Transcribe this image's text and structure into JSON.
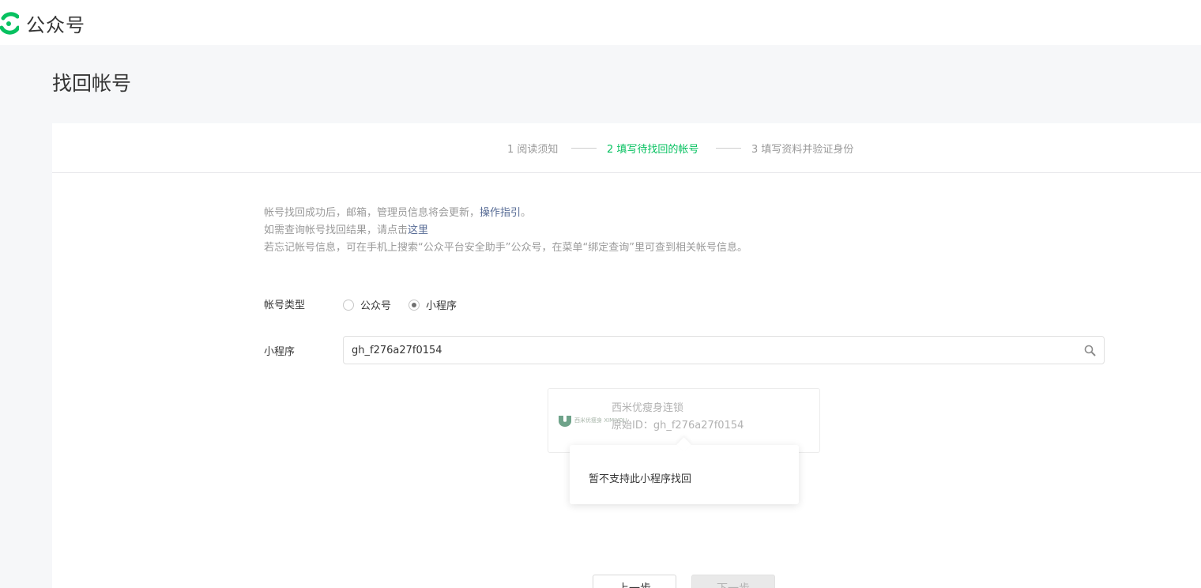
{
  "brand": {
    "name": "公众号",
    "accent": "#07c160"
  },
  "page": {
    "title": "找回帐号"
  },
  "steps": [
    {
      "label": "1 阅读须知",
      "active": false
    },
    {
      "label": "2 填写待找回的帐号",
      "active": true
    },
    {
      "label": "3 填写资料并验证身份",
      "active": false
    }
  ],
  "notice": {
    "line1_text": "帐号找回成功后，邮箱，管理员信息将会更新，",
    "line1_link": "操作指引",
    "line1_end": "。",
    "line2_text": "如需查询帐号找回结果，请点击",
    "line2_link": "这里",
    "line3_text": "若忘记帐号信息，可在手机上搜索“公众平台安全助手”公众号，在菜单“绑定查询”里可查到相关帐号信息。"
  },
  "form": {
    "type_label": "帐号类型",
    "options": [
      {
        "label": "公众号",
        "checked": false
      },
      {
        "label": "小程序",
        "checked": true
      }
    ],
    "app_label": "小程序",
    "search_value": "gh_f276a27f0154",
    "search_icon": "search-icon"
  },
  "result": {
    "logo_text": "西米优瘦身 XIMIYOU",
    "name": "西米优瘦身连锁",
    "id_text": "原始ID：gh_f276a27f0154"
  },
  "tooltip": {
    "text": "暂不支持此小程序找回"
  },
  "buttons": {
    "prev": "上一步",
    "next": "下一步"
  }
}
